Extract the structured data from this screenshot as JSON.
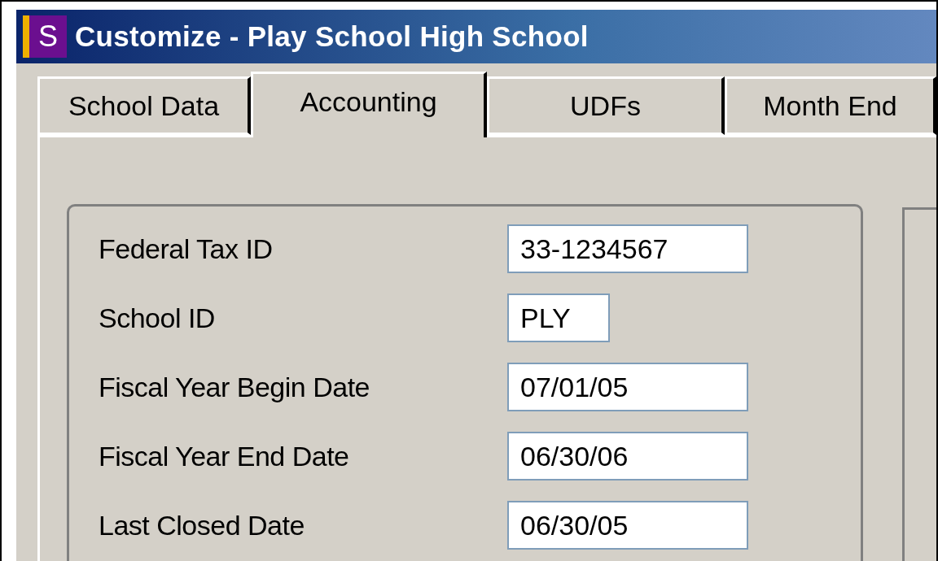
{
  "window": {
    "icon_letter": "S",
    "title": "Customize - Play School High School"
  },
  "tabs": [
    {
      "label": "School Data",
      "selected": false
    },
    {
      "label": "Accounting",
      "selected": true
    },
    {
      "label": "UDFs",
      "selected": false
    },
    {
      "label": "Month End",
      "selected": false
    }
  ],
  "fields": [
    {
      "label": "Federal Tax ID",
      "value": "33-1234567",
      "kind": "wide"
    },
    {
      "label": "School ID",
      "value": "PLY",
      "kind": "short"
    },
    {
      "label": "Fiscal Year Begin Date",
      "value": "07/01/05",
      "kind": "wide"
    },
    {
      "label": "Fiscal Year End Date",
      "value": "06/30/06",
      "kind": "wide"
    },
    {
      "label": "Last Closed Date",
      "value": "06/30/05",
      "kind": "wide"
    }
  ]
}
